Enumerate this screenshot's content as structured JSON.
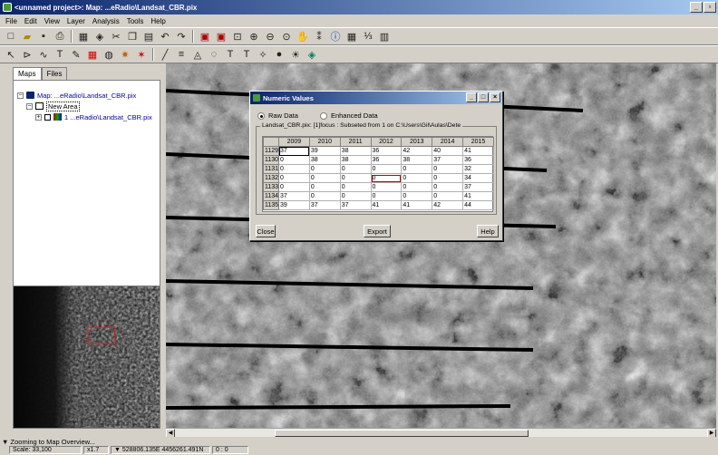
{
  "window": {
    "title": "<unnamed project>: Map: ...eRadio\\Landsat_CBR.pix",
    "min": "_",
    "restore": "▫"
  },
  "menu": [
    "File",
    "Edit",
    "View",
    "Layer",
    "Analysis",
    "Tools",
    "Help"
  ],
  "left_panel": {
    "tabs": [
      "Maps",
      "Files"
    ],
    "tree": {
      "map_label": "Map: ...eRadio\\Landsat_CBR.pix",
      "area_label": "New Area",
      "layer_label": "1 ...eRadio\\Landsat_CBR.pix"
    }
  },
  "dialog": {
    "title": "Numeric Values",
    "radio_raw": "Raw Data",
    "radio_enhanced": "Enhanced Data",
    "group_label": "Landsat_CBR.pix: [1]focus : Subseted from 1 on C:\\Users\\Gil\\Aulas\\Dete",
    "columns": [
      "2009",
      "2010",
      "2011",
      "2012",
      "2013",
      "2014",
      "2015"
    ],
    "rows": [
      {
        "label": "1129",
        "values": [
          "37",
          "39",
          "38",
          "36",
          "42",
          "40",
          "41"
        ]
      },
      {
        "label": "1130",
        "values": [
          "0",
          "38",
          "38",
          "36",
          "38",
          "37",
          "36"
        ]
      },
      {
        "label": "1131",
        "values": [
          "0",
          "0",
          "0",
          "0",
          "0",
          "0",
          "32"
        ]
      },
      {
        "label": "1132",
        "values": [
          "0",
          "0",
          "0",
          "0",
          "0",
          "0",
          "34"
        ]
      },
      {
        "label": "1133",
        "values": [
          "0",
          "0",
          "0",
          "0",
          "0",
          "0",
          "37"
        ]
      },
      {
        "label": "1134",
        "values": [
          "37",
          "0",
          "0",
          "0",
          "0",
          "0",
          "41"
        ]
      },
      {
        "label": "1135",
        "values": [
          "39",
          "37",
          "37",
          "41",
          "41",
          "42",
          "44"
        ]
      }
    ],
    "close_label": "Close",
    "export_label": "Export",
    "help_label": "Help"
  },
  "status": {
    "message": "Zooming to Map Overview...",
    "scale": "Scale: 33,100",
    "zoom": "x1.7",
    "coords": "528806.135E 4456261.491N",
    "value": "0 : 0"
  }
}
